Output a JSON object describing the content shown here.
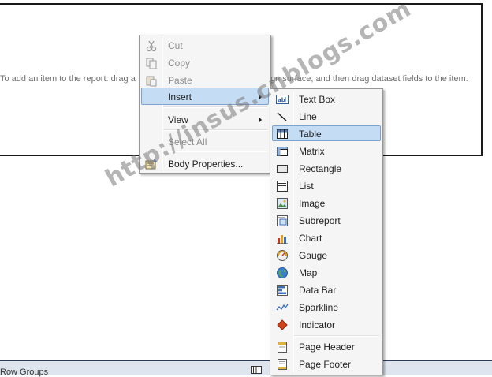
{
  "surface": {
    "hint_left": "To add an item to the report: drag a",
    "hint_right": "gn surface, and then drag dataset fields to the item."
  },
  "context_menu": {
    "items": [
      {
        "label": "Cut",
        "icon": "scissors-icon",
        "disabled": true
      },
      {
        "label": "Copy",
        "icon": "copy-icon",
        "disabled": true
      },
      {
        "label": "Paste",
        "icon": "paste-icon",
        "disabled": true
      },
      {
        "label": "Insert",
        "highlighted": true,
        "submenu": true
      },
      {
        "label": "View",
        "submenu": true
      },
      {
        "label": "Select All",
        "disabled": true
      },
      {
        "label": "Body Properties...",
        "icon": "properties-icon"
      }
    ]
  },
  "insert_submenu": {
    "items": [
      {
        "label": "Text Box",
        "icon": "textbox-icon"
      },
      {
        "label": "Line",
        "icon": "line-icon"
      },
      {
        "label": "Table",
        "icon": "table-icon",
        "highlighted": true
      },
      {
        "label": "Matrix",
        "icon": "matrix-icon"
      },
      {
        "label": "Rectangle",
        "icon": "rectangle-icon"
      },
      {
        "label": "List",
        "icon": "list-icon"
      },
      {
        "label": "Image",
        "icon": "image-icon"
      },
      {
        "label": "Subreport",
        "icon": "subreport-icon"
      },
      {
        "label": "Chart",
        "icon": "chart-icon"
      },
      {
        "label": "Gauge",
        "icon": "gauge-icon"
      },
      {
        "label": "Map",
        "icon": "map-icon"
      },
      {
        "label": "Data Bar",
        "icon": "databar-icon"
      },
      {
        "label": "Sparkline",
        "icon": "sparkline-icon"
      },
      {
        "label": "Indicator",
        "icon": "indicator-icon"
      },
      {
        "label": "Page Header",
        "icon": "page-header-icon"
      },
      {
        "label": "Page Footer",
        "icon": "page-footer-icon"
      }
    ]
  },
  "bottom_bar": {
    "label": "Row Groups"
  },
  "watermark": "http://insus.cnblogs.com",
  "colors": {
    "highlight": "#c5dcf5",
    "highlight_border": "#7da2ce",
    "menu_bg": "#f5f5f5",
    "bar_border": "#2d3c58"
  }
}
